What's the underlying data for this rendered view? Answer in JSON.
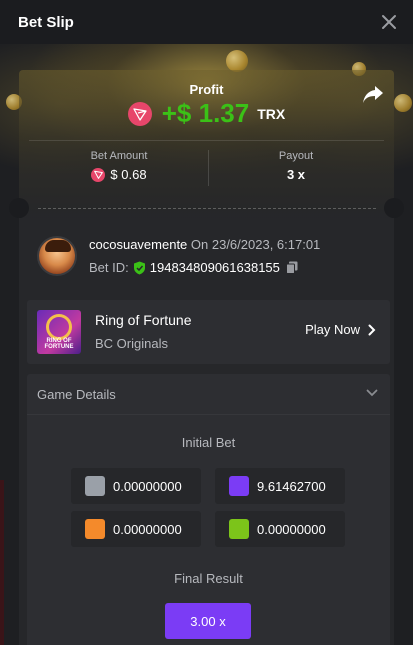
{
  "header": {
    "title": "Bet Slip"
  },
  "profit": {
    "label": "Profit",
    "value": "+$ 1.37",
    "currency": "TRX"
  },
  "bet_amount": {
    "label": "Bet Amount",
    "value": "$ 0.68"
  },
  "payout": {
    "label": "Payout",
    "value": "3 x"
  },
  "user": {
    "name": "cocosuavemente",
    "date": "On 23/6/2023, 6:17:01",
    "bet_id_label": "Bet ID:",
    "bet_id": "194834809061638155"
  },
  "game": {
    "name": "Ring of Fortune",
    "provider": "BC Originals",
    "play_label": "Play Now",
    "thumb_text": "RING OF FORTUNE"
  },
  "details": {
    "title": "Game Details",
    "initial_bet_label": "Initial Bet",
    "bets": [
      {
        "color": "#9aa0a8",
        "value": "0.00000000"
      },
      {
        "color": "#7b3cf5",
        "value": "9.61462700"
      },
      {
        "color": "#f48a2b",
        "value": "0.00000000"
      },
      {
        "color": "#7cc41a",
        "value": "0.00000000"
      }
    ],
    "final_result_label": "Final Result",
    "final_result": "3.00 x"
  },
  "colors": {
    "accent": "#7b3cf5",
    "profit": "#3bc117",
    "trx": "#e7466a"
  },
  "icons": [
    "close-icon",
    "trx-icon",
    "share-icon",
    "verified-shield-icon",
    "copy-icon",
    "chevron-right-icon",
    "chevron-down-icon"
  ]
}
